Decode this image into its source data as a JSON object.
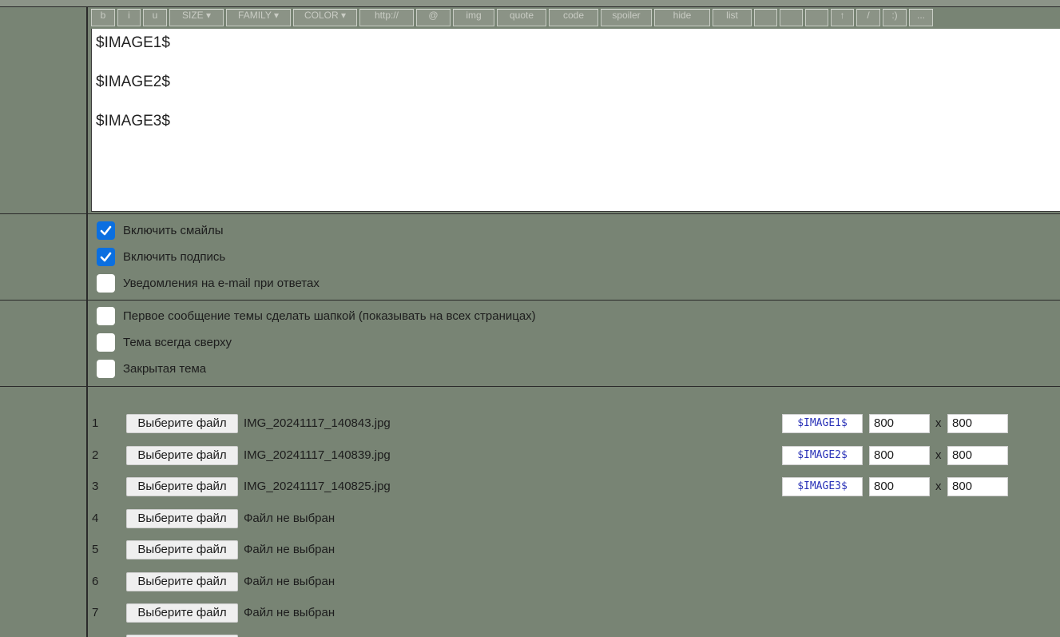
{
  "toolbar": {
    "buttons": [
      {
        "label": "b"
      },
      {
        "label": "i"
      },
      {
        "label": "u"
      },
      {
        "label": "SIZE ▾"
      },
      {
        "label": "FAMILY ▾"
      },
      {
        "label": "COLOR ▾"
      },
      {
        "label": "http://"
      },
      {
        "label": "@"
      },
      {
        "label": "img"
      },
      {
        "label": "quote"
      },
      {
        "label": "code"
      },
      {
        "label": "spoiler"
      },
      {
        "label": "hide"
      },
      {
        "label": "list"
      },
      {
        "label": ""
      },
      {
        "label": ""
      },
      {
        "label": ""
      },
      {
        "label": "↑"
      },
      {
        "label": "/"
      },
      {
        "label": ":)"
      },
      {
        "label": "..."
      }
    ]
  },
  "editor": {
    "lines": [
      "$IMAGE1$",
      "$IMAGE2$",
      "$IMAGE3$"
    ]
  },
  "options_group1": [
    {
      "label": "Включить смайлы",
      "checked": true
    },
    {
      "label": "Включить подпись",
      "checked": true
    },
    {
      "label": "Уведомления на e-mail при ответах",
      "checked": false
    }
  ],
  "options_group2": [
    {
      "label": "Первое сообщение темы сделать шапкой (показывать на всех страницах)",
      "checked": false
    },
    {
      "label": "Тема всегда сверху",
      "checked": false
    },
    {
      "label": "Закрытая тема",
      "checked": false
    }
  ],
  "attachments": {
    "button_label": "Выберите файл",
    "dim_separator": "x",
    "rows": [
      {
        "num": "1",
        "file": "IMG_20241117_140843.jpg",
        "tag": "$IMAGE1$",
        "width": "800",
        "height": "800"
      },
      {
        "num": "2",
        "file": "IMG_20241117_140839.jpg",
        "tag": "$IMAGE2$",
        "width": "800",
        "height": "800"
      },
      {
        "num": "3",
        "file": "IMG_20241117_140825.jpg",
        "tag": "$IMAGE3$",
        "width": "800",
        "height": "800"
      },
      {
        "num": "4",
        "file": "Файл не выбран"
      },
      {
        "num": "5",
        "file": "Файл не выбран"
      },
      {
        "num": "6",
        "file": "Файл не выбран"
      },
      {
        "num": "7",
        "file": "Файл не выбран"
      }
    ]
  },
  "colors": {
    "background": "#788474",
    "checkbox_checked": "#0b6fe0",
    "tag_text": "#2b33b8"
  }
}
